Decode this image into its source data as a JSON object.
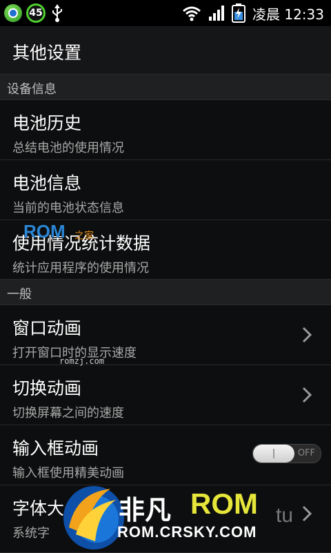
{
  "status_bar": {
    "notification_count": "45",
    "time_period": "凌晨",
    "time": "12:33"
  },
  "title_bar": {
    "title": "其他设置"
  },
  "sections": [
    {
      "header": "设备信息"
    },
    {
      "header": "一般"
    }
  ],
  "rows": [
    {
      "label": "电池历史",
      "summary": "总结电池的使用情况"
    },
    {
      "label": "电池信息",
      "summary": "当前的电池状态信息"
    },
    {
      "label": "使用情况统计数据",
      "summary": "统计应用程序的使用情况"
    },
    {
      "label": "窗口动画",
      "summary": "打开窗口时的显示速度"
    },
    {
      "label": "切换动画",
      "summary": "切换屏幕之间的速度"
    },
    {
      "label": "输入框动画",
      "summary": "输入框使用精美动画",
      "toggle_text": "OFF"
    },
    {
      "label": "字体大",
      "summary": "系统字"
    }
  ],
  "watermarks": {
    "rom": "ROM",
    "zhijia": "之家",
    "url": "romzj.com",
    "feifan": "非凡",
    "feifan_rom": "ROM",
    "site": "ROM.CRSKY.COM",
    "tu": "tu"
  },
  "icons": {
    "status": [
      "app-circle-icon",
      "notification-count-badge",
      "usb-icon",
      "wifi-icon",
      "signal-icon",
      "battery-charging-icon"
    ],
    "row_arrow": "chevron-right-icon"
  }
}
